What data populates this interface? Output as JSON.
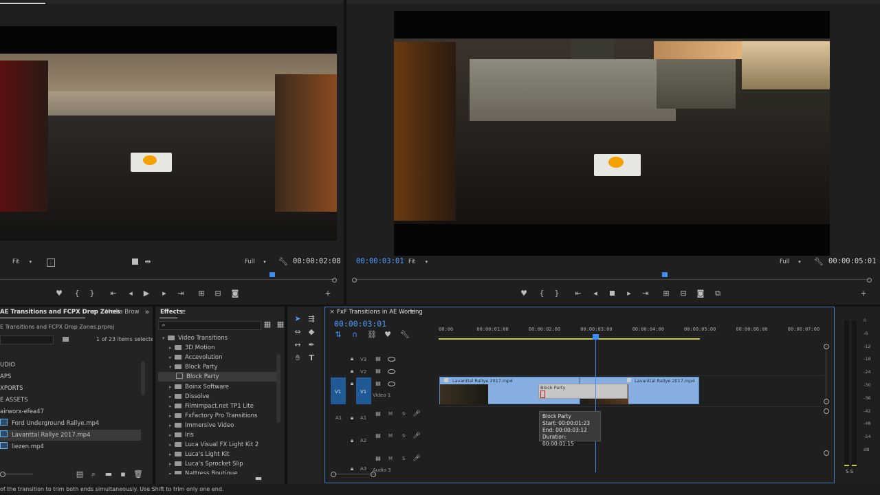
{
  "source_monitor": {
    "fit": "Fit",
    "quality": "Full",
    "timecode": "00:00:02:08"
  },
  "program_monitor": {
    "timecode_left": "00:00:03:01",
    "fit": "Fit",
    "quality": "Full",
    "timecode_right": "00:00:05:01"
  },
  "project_panel": {
    "tab_title": "AE Transitions and FCPX Drop Zones",
    "tab_media": "Media Brow",
    "file_name": "E Transitions and FCPX Drop Zones.prproj",
    "items_selected": "1 of 23 items selected",
    "tree": [
      "UDIO",
      "APS",
      "XPORTS",
      "E ASSETS",
      "airworx-efea47"
    ],
    "files": [
      "Ford Underground Rallye.mp4",
      "Lavanttal Rallye 2017.mp4",
      "liezen.mp4"
    ]
  },
  "effects_panel": {
    "title": "Effects",
    "search_placeholder": "",
    "items": [
      {
        "label": "Video Transitions",
        "level": 0,
        "open": true
      },
      {
        "label": "3D Motion",
        "level": 1,
        "open": false
      },
      {
        "label": "Accevolution",
        "level": 1,
        "open": false
      },
      {
        "label": "Block Party",
        "level": 1,
        "open": true
      },
      {
        "label": "Block Party",
        "level": 2,
        "open": false
      },
      {
        "label": "Boinx Software",
        "level": 1,
        "open": false
      },
      {
        "label": "Dissolve",
        "level": 1,
        "open": false
      },
      {
        "label": "Filmimpact.net TP1 Lite",
        "level": 1,
        "open": false
      },
      {
        "label": "FxFactory Pro Transitions",
        "level": 1,
        "open": false
      },
      {
        "label": "Immersive Video",
        "level": 1,
        "open": false
      },
      {
        "label": "Iris",
        "level": 1,
        "open": false
      },
      {
        "label": "Luca Visual FX Light Kit 2",
        "level": 1,
        "open": false
      },
      {
        "label": "Luca's Light Kit",
        "level": 1,
        "open": false
      },
      {
        "label": "Luca's Sprocket Slip",
        "level": 1,
        "open": false
      },
      {
        "label": "Nattress Boutique",
        "level": 1,
        "open": false
      }
    ]
  },
  "timeline": {
    "title": "FxF Transitions in AE Working",
    "timecode": "00:00:03:01",
    "ruler_labels": [
      "00:00",
      "00:00:01:00",
      "00:00:02:00",
      "00:00:03:00",
      "00:00:04:00",
      "00:00:05:00",
      "00:00:06:00",
      "00:00:07:00"
    ],
    "tracks": {
      "v3": "V3",
      "v2": "V2",
      "v1": "V1",
      "v1_name": "Video 1",
      "v1_src": "V1",
      "a1": "A1",
      "a1_src": "A1",
      "a2": "A2",
      "a3": "A3",
      "a3_name": "Audio 3",
      "m": "M",
      "s": "S"
    },
    "clips": {
      "clip1": "Lavanttal Rallye 2017.mp4",
      "clip2": "Lavanttal Rallye 2017.mp4",
      "transition": "Block Party"
    },
    "tooltip": {
      "title": "Block Party",
      "start": "Start: 00:00:01:23",
      "end": "End: 00:00:03:12",
      "duration": "Duration: 00:00:01:15"
    }
  },
  "audio_meter": {
    "labels": [
      "0",
      "-6",
      "-12",
      "-18",
      "-24",
      "-30",
      "-36",
      "-42",
      "-48",
      "-54",
      "dB"
    ],
    "solo": "S S"
  },
  "status_bar": "of the transition to trim both ends simultaneously. Use Shift to trim only one end."
}
